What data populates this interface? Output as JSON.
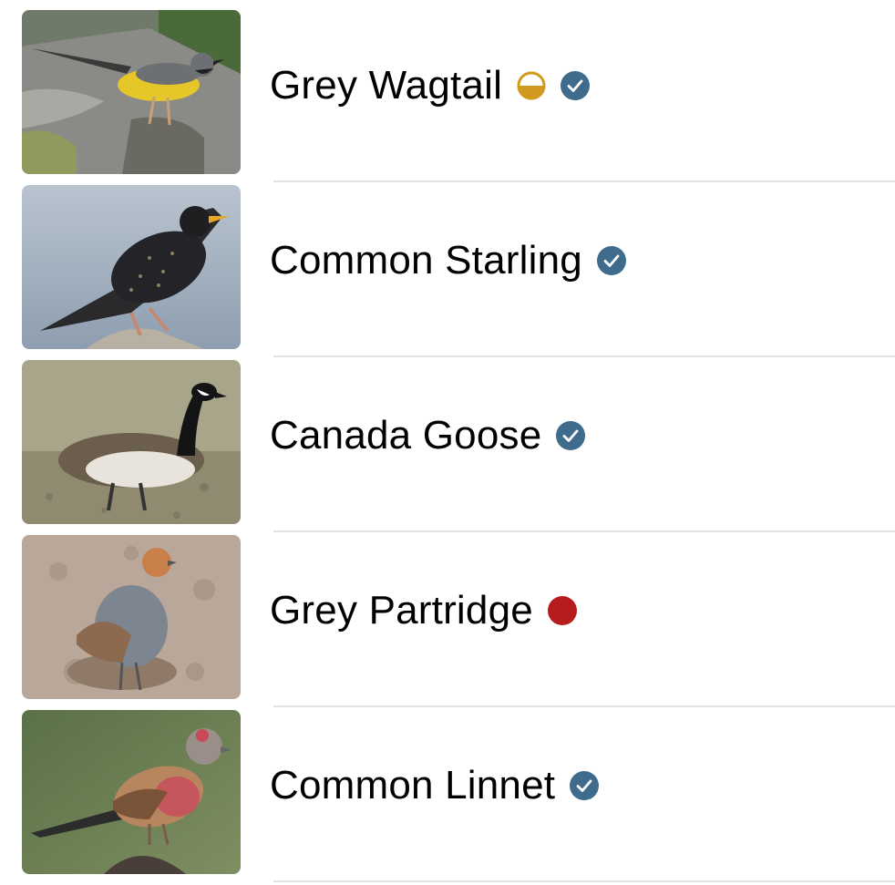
{
  "colors": {
    "verified": "#3f6c8c",
    "partial": "#d19a1e",
    "red": "#b61c1c",
    "separator": "#e3e3e6"
  },
  "species": [
    {
      "name": "Grey Wagtail",
      "badges": [
        "half-circle-icon",
        "verified-check-icon"
      ]
    },
    {
      "name": "Common Starling",
      "badges": [
        "verified-check-icon"
      ]
    },
    {
      "name": "Canada Goose",
      "badges": [
        "verified-check-icon"
      ]
    },
    {
      "name": "Grey Partridge",
      "badges": [
        "red-dot-icon"
      ]
    },
    {
      "name": "Common Linnet",
      "badges": [
        "verified-check-icon"
      ]
    }
  ]
}
